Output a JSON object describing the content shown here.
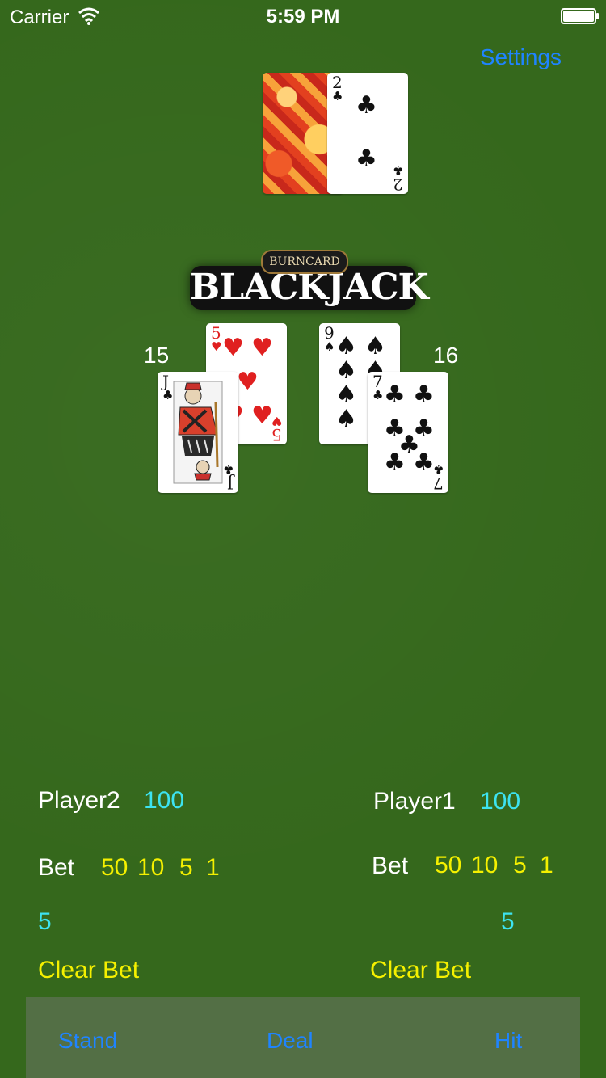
{
  "status_bar": {
    "carrier": "Carrier",
    "time": "5:59 PM"
  },
  "nav": {
    "settings_label": "Settings"
  },
  "dealer": {
    "up_card": {
      "rank": "2",
      "suit": "♣"
    }
  },
  "logo": {
    "top_text": "BURNCARD",
    "main_text": "BLACKJACK"
  },
  "player2_hand": {
    "score": "15",
    "cards": [
      {
        "rank": "5",
        "suit": "♥"
      },
      {
        "rank": "J",
        "suit": "♣"
      }
    ]
  },
  "player1_hand": {
    "score": "16",
    "cards": [
      {
        "rank": "9",
        "suit": "♠"
      },
      {
        "rank": "7",
        "suit": "♣"
      }
    ]
  },
  "player2": {
    "name": "Player2",
    "money": "100",
    "bet_label": "Bet",
    "chips": [
      "50",
      "10",
      "5",
      "1"
    ],
    "current_bet": "5",
    "clear_label": "Clear Bet"
  },
  "player1": {
    "name": "Player1",
    "money": "100",
    "bet_label": "Bet",
    "chips": [
      "50",
      "10",
      "5",
      "1"
    ],
    "current_bet": "5",
    "clear_label": "Clear Bet"
  },
  "toolbar": {
    "stand_label": "Stand",
    "deal_label": "Deal",
    "hit_label": "Hit"
  },
  "colors": {
    "felt": "#35681c",
    "accent_blue": "#1f84ff",
    "money_cyan": "#3de3f0",
    "chip_yellow": "#f5f000"
  }
}
